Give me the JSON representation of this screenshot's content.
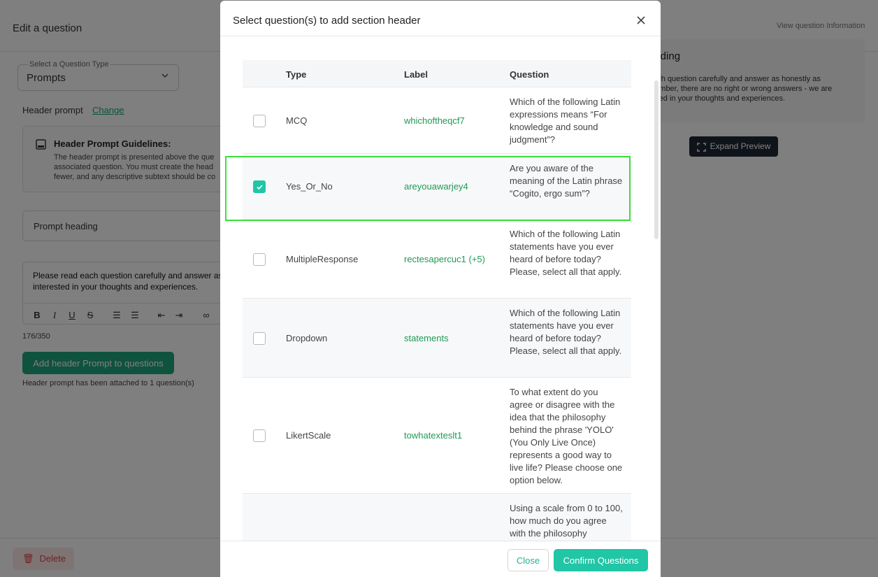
{
  "background": {
    "page_title": "Edit a question",
    "question_type": {
      "label": "Select a Question Type",
      "value": "Prompts"
    },
    "header_prompt_label": "Header prompt",
    "header_prompt_change": "Change",
    "guidelines": {
      "title": "Header Prompt Guidelines:",
      "lines": [
        "The header prompt is presented above the que",
        "associated question. You must create the head",
        "fewer, and any descriptive subtext should be co"
      ]
    },
    "prompt_heading": "Prompt heading",
    "editor_text_lines": [
      "Please read each question carefully and answer as",
      "interested in your thoughts and experiences."
    ],
    "char_counter": "176/350",
    "add_button": "Add header Prompt to questions",
    "attached_note": "Header prompt has been attached to 1 question(s)",
    "delete_button": "Delete",
    "view_info": "View question Information",
    "preview": {
      "title": "eading",
      "lines": [
        "each question carefully and answer as honestly as",
        "member, there are no right or wrong answers - we are",
        "ested in your thoughts and experiences."
      ]
    },
    "expand_button": "Expand Preview"
  },
  "modal": {
    "title": "Select question(s) to add section header",
    "columns": {
      "type": "Type",
      "label": "Label",
      "question": "Question"
    },
    "rows": [
      {
        "checked": false,
        "type": "MCQ",
        "label": "whichoftheqcf7",
        "question": "Which of the following Latin expressions means “For knowledge and sound judgment”?"
      },
      {
        "checked": true,
        "type": "Yes_Or_No",
        "label": "areyouawarjey4",
        "question": "Are you aware of the meaning of the Latin phrase “Cogito, ergo sum”?"
      },
      {
        "checked": false,
        "type": "MultipleResponse",
        "label": "rectesapercuc1 (+5)",
        "question": "Which of the following Latin statements have you ever heard of before today? Please, select all that apply."
      },
      {
        "checked": false,
        "type": "Dropdown",
        "label": "statements",
        "question": "Which of the following Latin statements have you ever heard of before today? Please, select all that apply."
      },
      {
        "checked": false,
        "type": "LikertScale",
        "label": "towhatexteslt1",
        "question": "To what extent do you agree or disagree with the idea that the philosophy behind the phrase 'YOLO' (You Only Live Once) represents a good way to live life? Please choose one option below."
      },
      {
        "checked": false,
        "type": "",
        "label": "",
        "question": "Using a scale from 0 to 100, how much do you agree with the philosophy"
      }
    ],
    "close_button": "Close",
    "confirm_button": "Confirm Questions",
    "colors": {
      "accent": "#20c6a6",
      "label_green": "#1f9a55",
      "highlight": "#3be03b"
    }
  }
}
